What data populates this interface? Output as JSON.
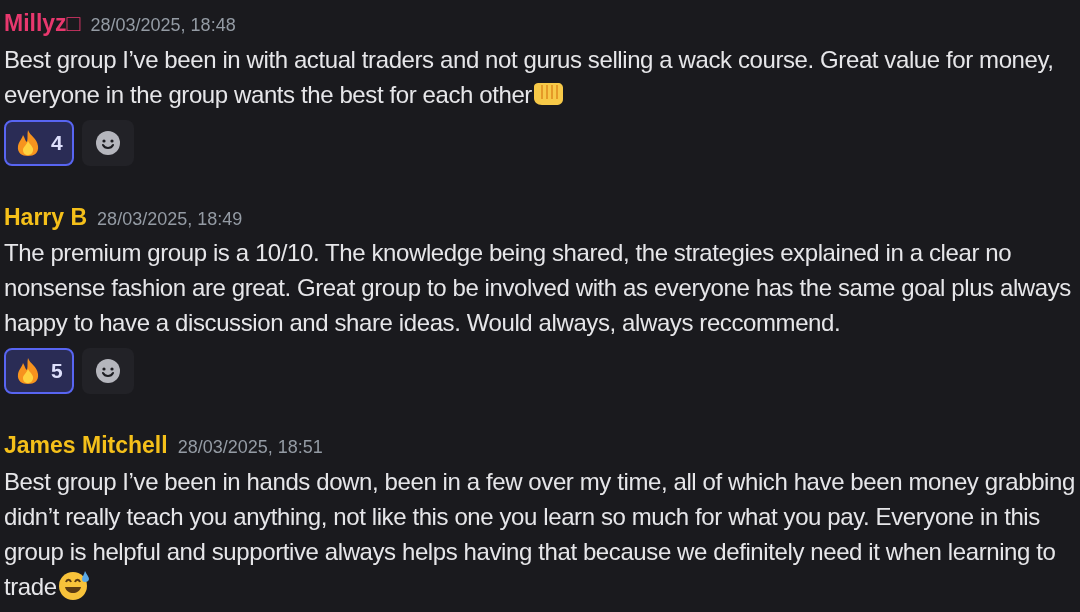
{
  "messages": [
    {
      "author": "Millyz□",
      "color": "#e8386e",
      "timestamp": "28/03/2025, 18:48",
      "text": "Best group I’ve been in with actual traders and not gurus selling a wack course. Great value for money, everyone in the group wants the best for each other",
      "trailing_icon": {
        "kind": "fist"
      },
      "reactions": [
        {
          "kind": "fire",
          "count": "4",
          "selected": true
        }
      ]
    },
    {
      "author": "Harry B",
      "color": "#f5c01a",
      "timestamp": "28/03/2025, 18:49",
      "text": "The premium group is a 10/10. The knowledge being shared, the strategies explained in a clear no nonsense fashion are great. Great group to be involved with as everyone has the same goal plus always happy to have a discussion and share ideas. Would always, always reccommend.",
      "reactions": [
        {
          "kind": "fire",
          "count": "5",
          "selected": true
        }
      ]
    },
    {
      "author": "James Mitchell",
      "color": "#f5c01a",
      "timestamp": "28/03/2025, 18:51",
      "text": "Best group I’ve been in hands down, been in a few over my time, all of which have been money grabbing didn’t really teach you anything, not like this one you learn so much for what you pay. Everyone in this group is helpful and supportive always helps having that because we definitely need it when learning to trade",
      "trailing_icon": {
        "kind": "sweat_smile"
      }
    }
  ]
}
